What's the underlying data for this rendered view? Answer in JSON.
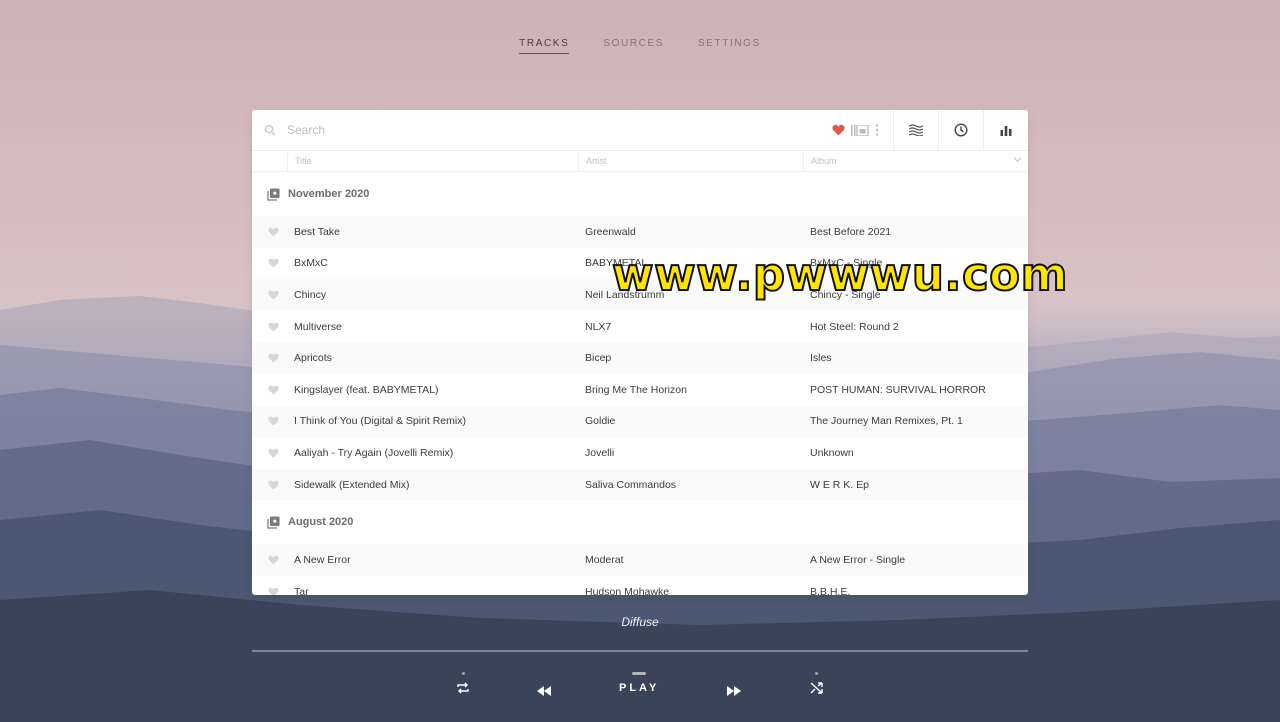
{
  "nav": {
    "tabs": [
      {
        "label": "TRACKS"
      },
      {
        "label": "SOURCES"
      },
      {
        "label": "SETTINGS"
      }
    ]
  },
  "search": {
    "placeholder": "Search",
    "value": ""
  },
  "columns": [
    "Title",
    "Artist",
    "Album"
  ],
  "groups": [
    {
      "label": "November 2020",
      "tracks": [
        {
          "title": "Best Take",
          "artist": "Greenwald",
          "album": "Best Before 2021"
        },
        {
          "title": "BxMxC",
          "artist": "BABYMETAL",
          "album": "BxMxC - Single"
        },
        {
          "title": "Chincy",
          "artist": "Neil Landstrumm",
          "album": "Chincy - Single"
        },
        {
          "title": "Multiverse",
          "artist": "NLX7",
          "album": "Hot Steel: Round 2"
        },
        {
          "title": "Apricots",
          "artist": "Bicep",
          "album": "Isles"
        },
        {
          "title": "Kingslayer (feat. BABYMETAL)",
          "artist": "Bring Me The Horizon",
          "album": "POST HUMAN: SURVIVAL HORROR"
        },
        {
          "title": "I Think of You (Digital & Spirit Remix)",
          "artist": "Goldie",
          "album": "The Journey Man Remixes, Pt. 1"
        },
        {
          "title": "Aaliyah - Try Again (Jovelli Remix)",
          "artist": "Jovelli",
          "album": "Unknown"
        },
        {
          "title": "Sidewalk (Extended Mix)",
          "artist": "Saliva Commandos",
          "album": "W E R K. Ep"
        }
      ]
    },
    {
      "label": "August 2020",
      "tracks": [
        {
          "title": "A New Error",
          "artist": "Moderat",
          "album": "A New Error - Single"
        },
        {
          "title": "Tar",
          "artist": "Hudson Mohawke",
          "album": "B.B.H.E."
        }
      ]
    }
  ],
  "player": {
    "now_playing": "Diffuse",
    "play_label": "PLAY",
    "progress": 0
  },
  "colors": {
    "favorite": "#e0574f",
    "heart_inactive": "#d6d6d6"
  },
  "watermark": "www.pwwwu.com"
}
